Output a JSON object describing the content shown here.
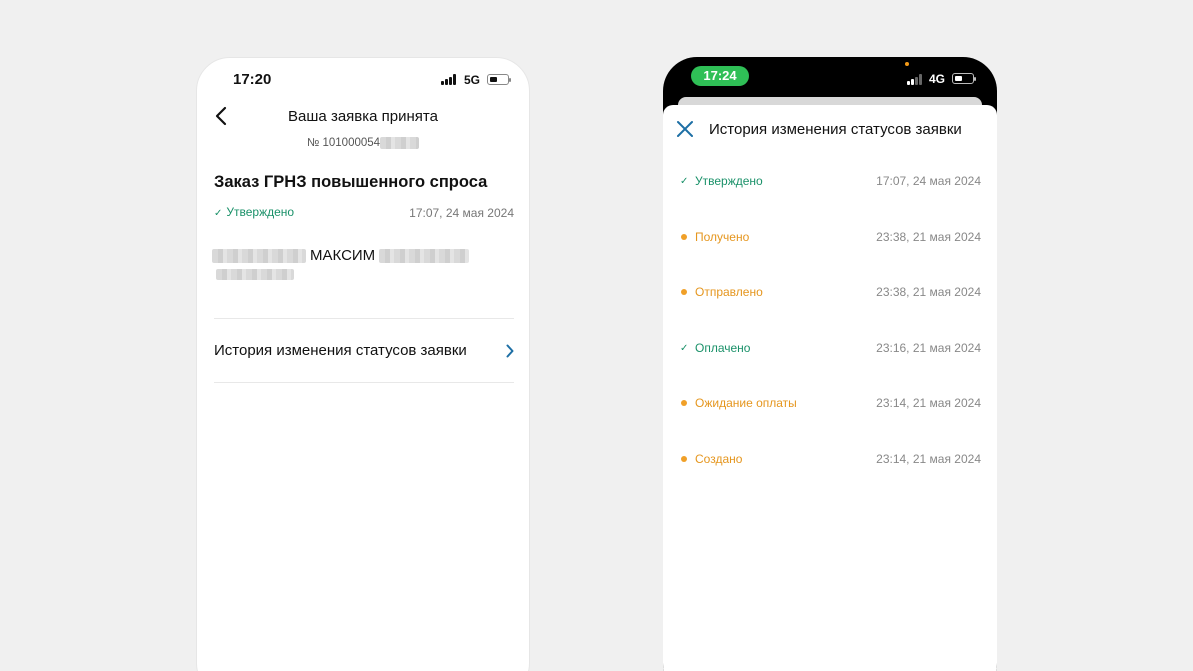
{
  "left_screen": {
    "status_bar": {
      "time": "17:20",
      "network": "5G"
    },
    "title": "Ваша заявка принята",
    "request_number": "№ 101000054",
    "order_title": "Заказ ГРНЗ повышенного спроса",
    "status": {
      "check": "✓",
      "label": "Утверждено",
      "time": "17:07, 24 мая 2024"
    },
    "applicant_name": "МАКСИМ",
    "history_link": "История изменения статусов заявки"
  },
  "right_screen": {
    "status_bar": {
      "time": "17:24",
      "network": "4G"
    },
    "sheet_title": "История изменения статусов заявки",
    "history": [
      {
        "label": "Утверждено",
        "time": "17:07, 24 мая 2024",
        "kind": "check",
        "color": "#1a9169"
      },
      {
        "label": "Получено",
        "time": "23:38, 21 мая 2024",
        "kind": "dot",
        "color": "#e5961e"
      },
      {
        "label": "Отправлено",
        "time": "23:38, 21 мая 2024",
        "kind": "dot",
        "color": "#e5961e"
      },
      {
        "label": "Оплачено",
        "time": "23:16, 21 мая 2024",
        "kind": "check",
        "color": "#1a9169"
      },
      {
        "label": "Ожидание оплаты",
        "time": "23:14, 21 мая 2024",
        "kind": "dot",
        "color": "#e5961e"
      },
      {
        "label": "Создано",
        "time": "23:14, 21 мая 2024",
        "kind": "dot",
        "color": "#e5961e"
      }
    ]
  }
}
